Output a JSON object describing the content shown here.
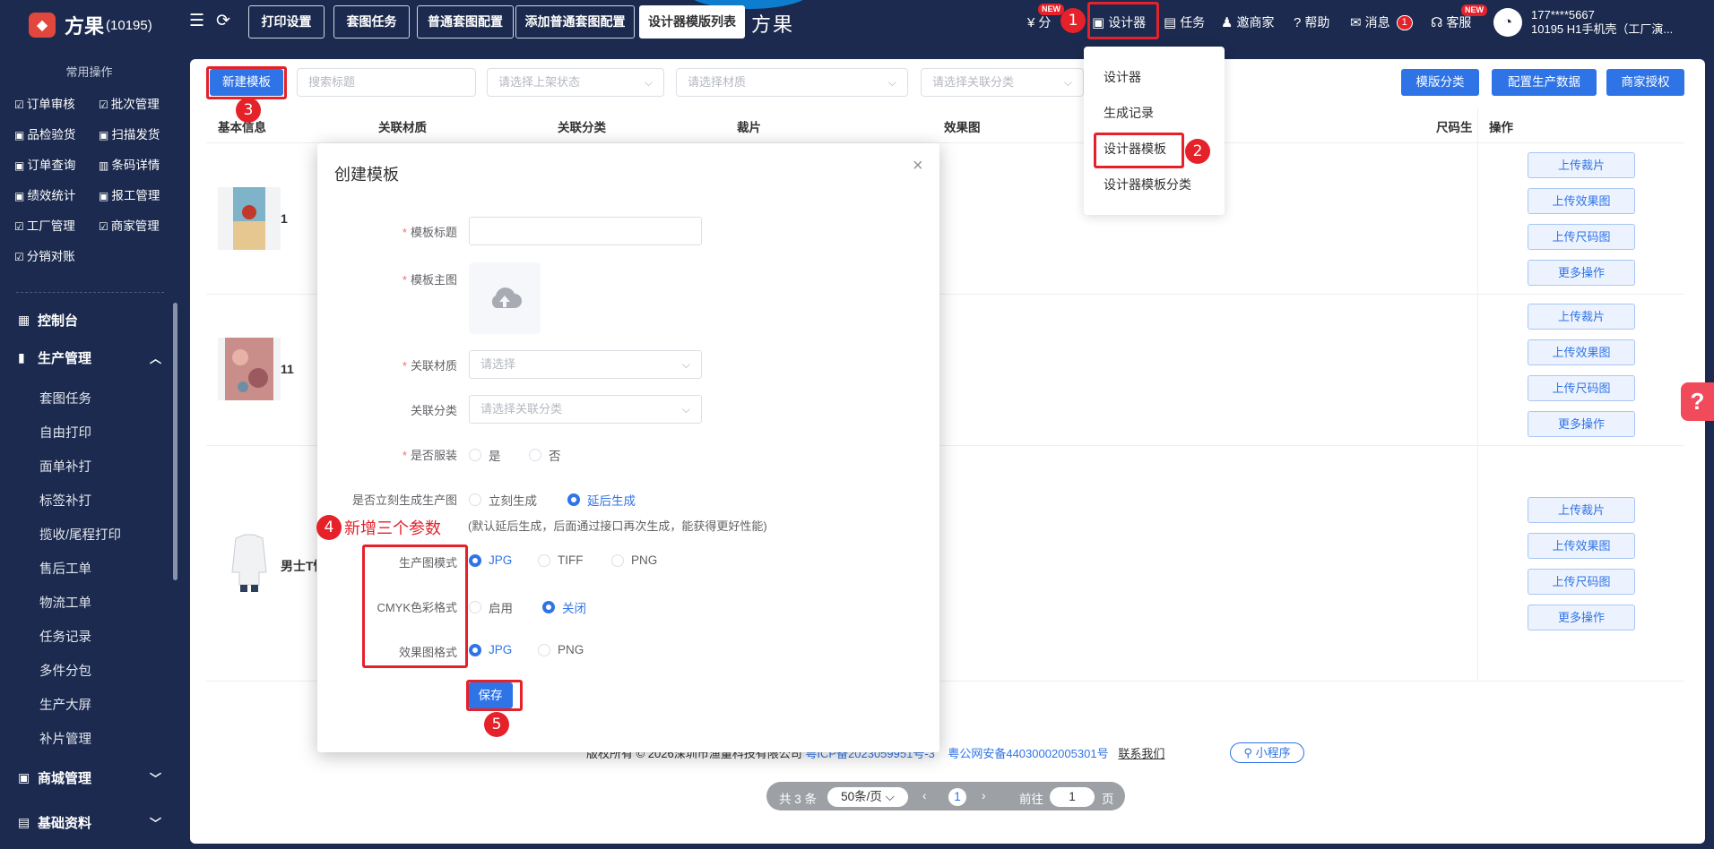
{
  "app": {
    "name": "方果",
    "count": "(10195)",
    "big_title": "方果",
    "faded_title": "方果"
  },
  "tabs": [
    {
      "label": "打印设置"
    },
    {
      "label": "套图任务"
    },
    {
      "label": "普通套图配置"
    },
    {
      "label": "添加普通套图配置"
    },
    {
      "label": "设计器模版列表"
    }
  ],
  "header": {
    "fen": "分",
    "designer": "设计器",
    "task": "任务",
    "invite": "邀商家",
    "help": "帮助",
    "msg": "消息",
    "msg_badge": "1",
    "service": "客服",
    "new_badge": "NEW",
    "user_line1": "177****5667",
    "user_line2": "10195 H1手机壳（工厂演..."
  },
  "dropdown": {
    "items": [
      "设计器",
      "生成记录",
      "设计器模板",
      "设计器模板分类"
    ]
  },
  "steps": [
    "1",
    "2",
    "3",
    "4",
    "5"
  ],
  "sidebar": {
    "section_title": "常用操作",
    "quick": [
      "订单审核",
      "批次管理",
      "品检验货",
      "扫描发货",
      "订单查询",
      "条码详情",
      "绩效统计",
      "报工管理",
      "工厂管理",
      "商家管理",
      "分销对账"
    ],
    "console": "控制台",
    "production": "生产管理",
    "production_items": [
      "套图任务",
      "自由打印",
      "面单补打",
      "标签补打",
      "揽收/尾程打印",
      "售后工单",
      "物流工单",
      "任务记录",
      "多件分包",
      "生产大屏",
      "补片管理"
    ],
    "mall": "商城管理",
    "basic": "基础资料"
  },
  "toolbar": {
    "new_button": "新建模板",
    "search_placeholder": "搜索标题",
    "status_placeholder": "请选择上架状态",
    "material_placeholder": "请选择材质",
    "category_placeholder": "请选择关联分类",
    "btn_category": "模版分类",
    "btn_config": "配置生产数据",
    "btn_auth": "商家授权"
  },
  "table": {
    "headers": [
      "基本信息",
      "关联材质",
      "关联分类",
      "裁片",
      "效果图",
      "尺码生产",
      "操作"
    ],
    "rows": [
      {
        "label": "1"
      },
      {
        "label": "11"
      },
      {
        "label": "男士T恤"
      }
    ],
    "ops": [
      "上传裁片",
      "上传效果图",
      "上传尺码图",
      "更多操作"
    ]
  },
  "dialog": {
    "title": "创建模板",
    "close": "×",
    "f_title": "模板标题",
    "f_main": "模板主图",
    "f_material": "关联材质",
    "material_placeholder": "请选择",
    "f_category": "关联分类",
    "category_placeholder": "请选择关联分类",
    "f_clothing": "是否服装",
    "yes": "是",
    "no": "否",
    "f_immediate": "是否立刻生成生产图",
    "immediate": "立刻生成",
    "delayed": "延后生成",
    "note": "(默认延后生成，后面通过接口再次生成，能获得更好性能)",
    "new_params": "新增三个参数",
    "f_prod_mode": "生产图模式",
    "jpg": "JPG",
    "tiff": "TIFF",
    "png": "PNG",
    "f_cmyk": "CMYK色彩格式",
    "enable": "启用",
    "close_opt": "关闭",
    "f_effect": "效果图格式",
    "save": "保存"
  },
  "footer": {
    "copyright": "版权所有 © 2026深圳市渔量科技有限公司",
    "icp": "粤ICP备2023059951号-3",
    "police": "粤公网安备44030002005301号",
    "contact": "联系我们",
    "mini": "小程序"
  },
  "pager": {
    "total": "共 3 条",
    "size": "50条/页",
    "current": "1",
    "goto": "前往",
    "page_input": "1",
    "page_suffix": "页"
  },
  "colors": {
    "primary": "#2f74e6",
    "sidebar": "#1b2a4e",
    "annotation": "#e5212a"
  }
}
